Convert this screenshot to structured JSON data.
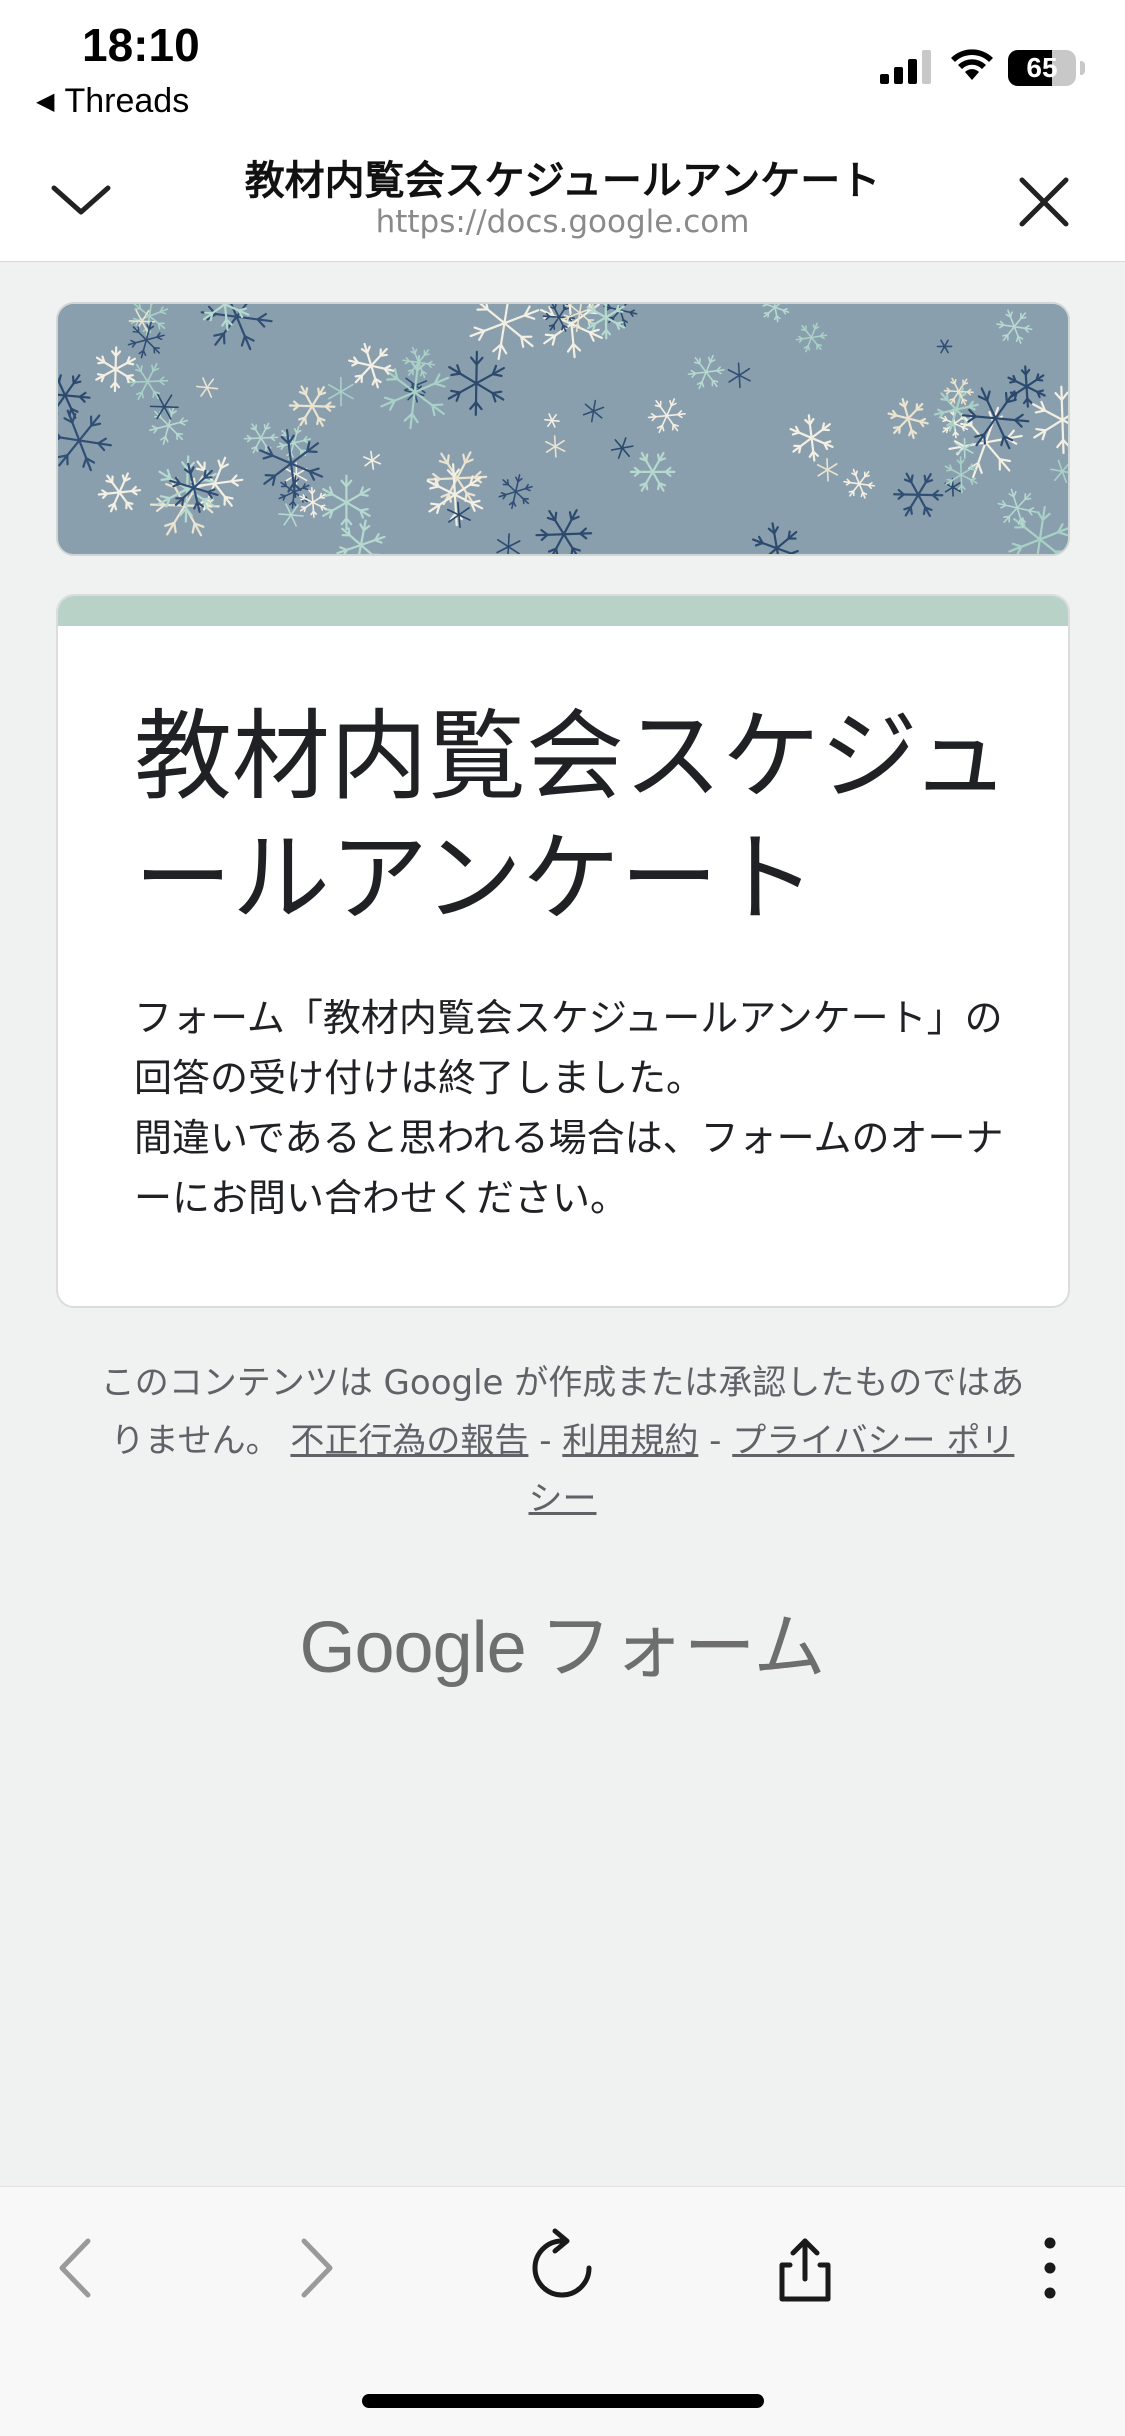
{
  "status_bar": {
    "time": "18:10",
    "back_app": "Threads",
    "battery_percent": 65,
    "battery_label": "65"
  },
  "browser_header": {
    "title": "教材内覧会スケジュールアンケート",
    "url": "https://docs.google.com"
  },
  "form": {
    "accent_color": "#b9d2c8",
    "title": "教材内覧会スケジュールアンケート",
    "closed_message_line1": "フォーム「教材内覧会スケジュールアンケート」の回答の受け付けは終了しました。",
    "closed_message_line2": "間違いであると思われる場合は、フォームのオーナーにお問い合わせください。"
  },
  "footer": {
    "disclaimer_text": "このコンテンツは Google が作成または承認したものではありません。",
    "link_report": "不正行為の報告",
    "separator": "-",
    "link_terms": "利用規約",
    "link_privacy": "プライバシー ポリシー",
    "brand_google": "Google",
    "brand_forms": "フォーム"
  },
  "toolbar": {
    "icons": [
      "back-icon",
      "forward-icon",
      "reload-icon",
      "share-icon",
      "more-icon"
    ]
  }
}
